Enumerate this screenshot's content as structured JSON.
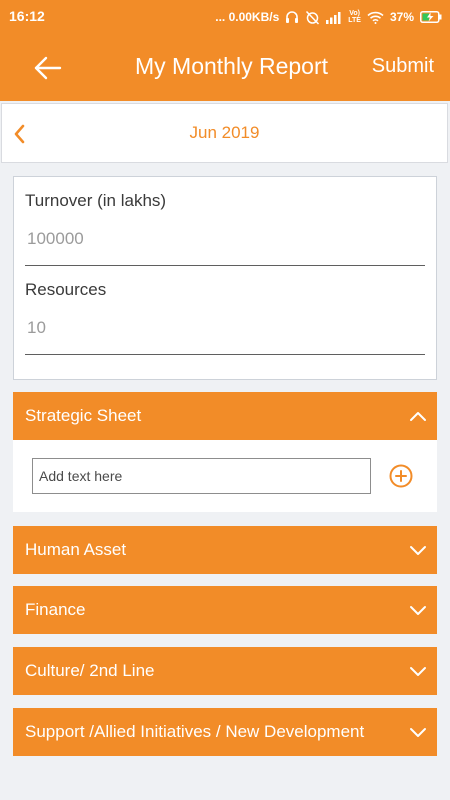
{
  "status_bar": {
    "time": "16:12",
    "network_speed": "... 0.00KB/s",
    "volte": "Vo)\nLTE",
    "battery": "37%",
    "icons": [
      "headset-icon",
      "alarm-off-icon",
      "signal-icon",
      "volte-icon",
      "wifi-icon",
      "battery-charging-icon"
    ]
  },
  "app_bar": {
    "back_icon": "back-arrow-icon",
    "title": "My Monthly Report",
    "submit_label": "Submit"
  },
  "month_selector": {
    "prev_icon": "chevron-left-icon",
    "month": "Jun 2019"
  },
  "summary": {
    "turnover_label": "Turnover (in lakhs)",
    "turnover_value": "100000",
    "resources_label": "Resources",
    "resources_value": "10"
  },
  "sections": [
    {
      "title": "Strategic Sheet",
      "expanded": true
    },
    {
      "title": "Human Asset",
      "expanded": false
    },
    {
      "title": "Finance",
      "expanded": false
    },
    {
      "title": "Culture/ 2nd Line",
      "expanded": false
    },
    {
      "title": "Support /Allied Initiatives / New Development",
      "expanded": false
    }
  ],
  "strategic_sheet": {
    "placeholder": "Add text here",
    "add_icon": "add-circle-icon"
  },
  "colors": {
    "primary": "#f28c28",
    "background": "#eff1f4",
    "card": "#ffffff"
  }
}
